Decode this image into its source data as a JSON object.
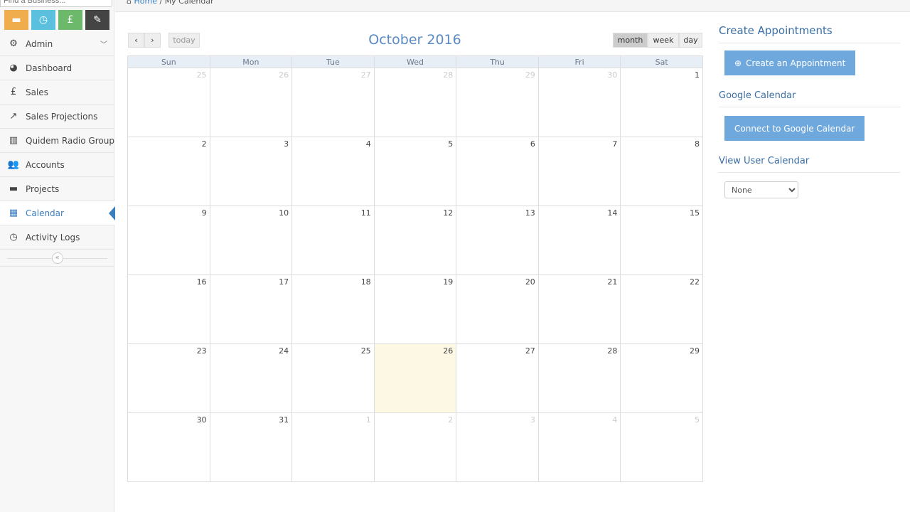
{
  "sidebar": {
    "search_placeholder": "Find a Business...",
    "shortcuts": [
      {
        "icon": "briefcase-icon",
        "glyph": "▬",
        "color": "#f0ad4e"
      },
      {
        "icon": "clock-icon",
        "glyph": "◷",
        "color": "#5bc0de"
      },
      {
        "icon": "pound-icon",
        "glyph": "£",
        "color": "#6cb96c"
      },
      {
        "icon": "edit-icon",
        "glyph": "✎",
        "color": "#444444"
      }
    ],
    "items": [
      {
        "label": "Admin",
        "icon": "gear-icon",
        "glyph": "⚙"
      },
      {
        "label": "Dashboard",
        "icon": "dashboard-icon",
        "glyph": "◕"
      },
      {
        "label": "Sales",
        "icon": "pound-icon",
        "glyph": "£"
      },
      {
        "label": "Sales Projections",
        "icon": "line-chart-icon",
        "glyph": "↗"
      },
      {
        "label": "Quidem Radio Group",
        "icon": "building-icon",
        "glyph": "▥"
      },
      {
        "label": "Accounts",
        "icon": "users-icon",
        "glyph": "👥"
      },
      {
        "label": "Projects",
        "icon": "briefcase-icon",
        "glyph": "▬"
      },
      {
        "label": "Calendar",
        "icon": "calendar-icon",
        "glyph": "▦"
      },
      {
        "label": "Activity Logs",
        "icon": "clock-icon",
        "glyph": "◷"
      }
    ],
    "collapse": "«"
  },
  "breadcrumb": {
    "home": "Home",
    "sep": "/",
    "current": "My Calendar"
  },
  "calendar": {
    "title": "October 2016",
    "today": "today",
    "prev": "‹",
    "next": "›",
    "views": [
      "month",
      "week",
      "day"
    ],
    "active_view": "month",
    "days": [
      "Sun",
      "Mon",
      "Tue",
      "Wed",
      "Thu",
      "Fri",
      "Sat"
    ],
    "weeks": [
      [
        "25",
        "26",
        "27",
        "28",
        "29",
        "30",
        "1"
      ],
      [
        "2",
        "3",
        "4",
        "5",
        "6",
        "7",
        "8"
      ],
      [
        "9",
        "10",
        "11",
        "12",
        "13",
        "14",
        "15"
      ],
      [
        "16",
        "17",
        "18",
        "19",
        "20",
        "21",
        "22"
      ],
      [
        "23",
        "24",
        "25",
        "26",
        "27",
        "28",
        "29"
      ],
      [
        "30",
        "31",
        "1",
        "2",
        "3",
        "4",
        "5"
      ]
    ],
    "highlighted": "26"
  },
  "right": {
    "create_heading": "Create Appointments",
    "create_btn": "Create an Appointment",
    "google_heading": "Google Calendar",
    "google_btn": "Connect to Google Calendar",
    "view_heading": "View User Calendar",
    "view_value": "None"
  }
}
